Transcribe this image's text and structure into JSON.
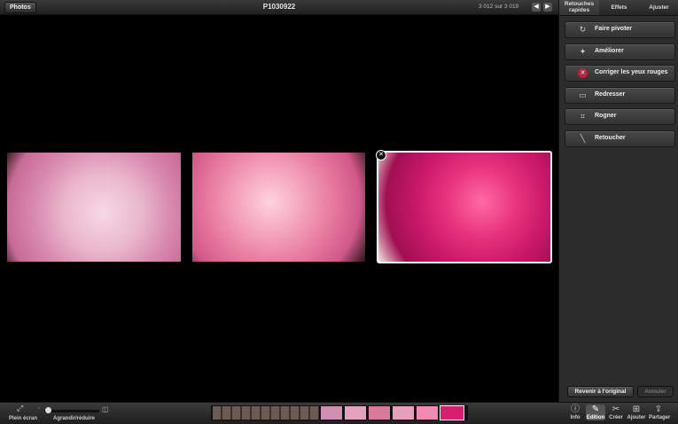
{
  "header": {
    "photos_button": "Photos",
    "title": "P1030922",
    "counter": "3 012 sur 3 019",
    "prev_icon": "arrow-left-icon",
    "next_icon": "arrow-right-icon"
  },
  "panel": {
    "tabs": [
      {
        "label": "Retouches rapides",
        "active": true
      },
      {
        "label": "Effets",
        "active": false
      },
      {
        "label": "Ajuster",
        "active": false
      }
    ],
    "tools": [
      {
        "label": "Faire pivoter",
        "icon": "rotate-icon"
      },
      {
        "label": "Améliorer",
        "icon": "magic-wand-icon"
      },
      {
        "label": "Corriger les yeux rouges",
        "icon": "red-eye-icon"
      },
      {
        "label": "Redresser",
        "icon": "straighten-icon"
      },
      {
        "label": "Rogner",
        "icon": "crop-icon"
      },
      {
        "label": "Retoucher",
        "icon": "brush-icon"
      }
    ],
    "revert_button": "Revenir à l'original",
    "cancel_button": "Annuler"
  },
  "bottom": {
    "fullscreen_label": "Plein écran",
    "zoom_label": "Agrandir/réduire",
    "tools": [
      {
        "label": "Info",
        "icon": "info-icon",
        "active": false
      },
      {
        "label": "Edition",
        "icon": "pencil-icon",
        "active": true
      },
      {
        "label": "Créer",
        "icon": "create-icon",
        "active": false
      },
      {
        "label": "Ajouter",
        "icon": "add-icon",
        "active": false
      },
      {
        "label": "Partager",
        "icon": "share-icon",
        "active": false
      }
    ]
  },
  "colors": {
    "accent_red": "#c0203a",
    "panel_bg": "#2c2c2c"
  }
}
